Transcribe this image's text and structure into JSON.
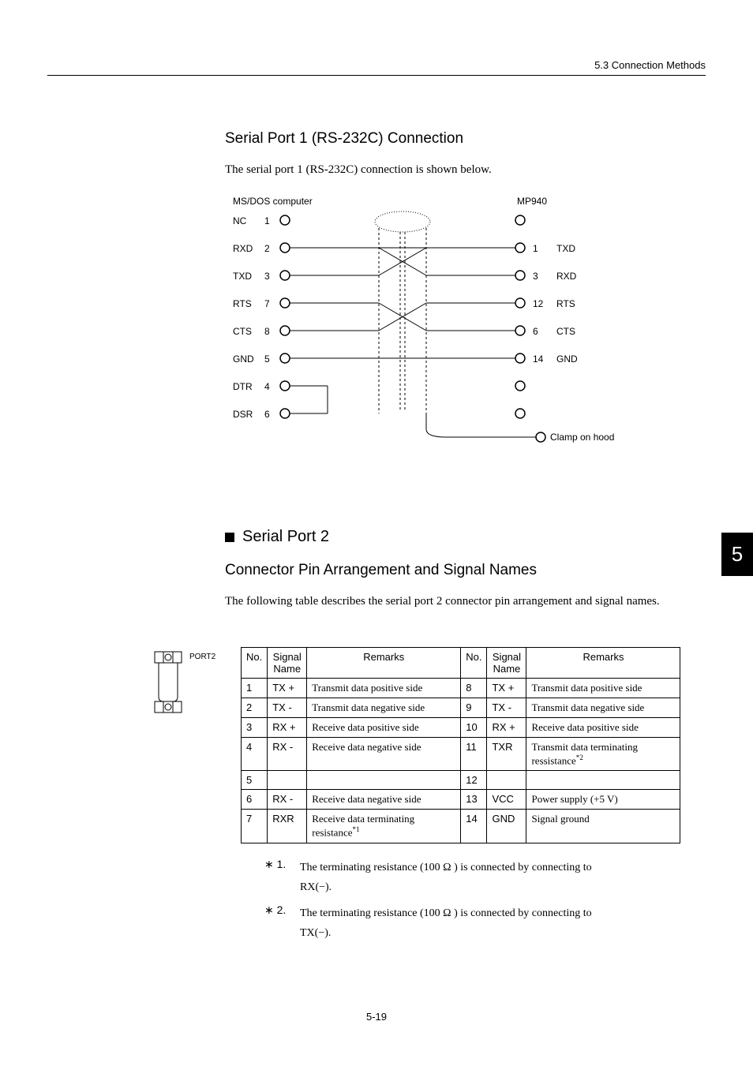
{
  "header": {
    "section": "5.3  Connection Methods"
  },
  "sec1": {
    "title": "Serial Port 1 (RS-232C) Connection",
    "intro": "The serial port 1 (RS-232C) connection is shown below."
  },
  "diagram": {
    "left_title": "MS/DOS computer",
    "right_title": "MP940",
    "left_pins": [
      {
        "label": "NC",
        "pin": "1"
      },
      {
        "label": "RXD",
        "pin": "2"
      },
      {
        "label": "TXD",
        "pin": "3"
      },
      {
        "label": "RTS",
        "pin": "7"
      },
      {
        "label": "CTS",
        "pin": "8"
      },
      {
        "label": "GND",
        "pin": "5"
      },
      {
        "label": "DTR",
        "pin": "4"
      },
      {
        "label": "DSR",
        "pin": "6"
      }
    ],
    "right_pins": [
      {
        "pin": "1",
        "label": "TXD"
      },
      {
        "pin": "3",
        "label": "RXD"
      },
      {
        "pin": "12",
        "label": "RTS"
      },
      {
        "pin": "6",
        "label": "CTS"
      },
      {
        "pin": "14",
        "label": "GND"
      }
    ],
    "clamp_label": "Clamp on hood"
  },
  "sec2": {
    "title": "Serial Port 2",
    "subtitle": "Connector Pin Arrangement and Signal Names",
    "intro": "The following table describes the serial port 2 connector pin arrangement and signal names."
  },
  "port_label": "PORT2",
  "table": {
    "headers": {
      "no": "No.",
      "signal": "Signal Name",
      "remarks": "Remarks"
    },
    "rows": [
      {
        "l_no": "1",
        "l_sig": "TX +",
        "l_rem": "Transmit data positive side",
        "r_no": "8",
        "r_sig": "TX +",
        "r_rem": "Transmit data positive side"
      },
      {
        "l_no": "2",
        "l_sig": "TX -",
        "l_rem": "Transmit data negative side",
        "r_no": "9",
        "r_sig": "TX -",
        "r_rem": "Transmit data negative side"
      },
      {
        "l_no": "3",
        "l_sig": "RX +",
        "l_rem": "Receive data positive side",
        "r_no": "10",
        "r_sig": "RX +",
        "r_rem": "Receive data positive side"
      },
      {
        "l_no": "4",
        "l_sig": "RX -",
        "l_rem": "Receive data negative side",
        "r_no": "11",
        "r_sig": "TXR",
        "r_rem": "Transmit data terminating ressistance",
        "r_sup": "*2"
      },
      {
        "l_no": "5",
        "l_sig": "",
        "l_rem": "",
        "r_no": "12",
        "r_sig": "",
        "r_rem": ""
      },
      {
        "l_no": "6",
        "l_sig": "RX -",
        "l_rem": "Receive data negative side",
        "r_no": "13",
        "r_sig": "VCC",
        "r_rem": "Power supply (+5 V)"
      },
      {
        "l_no": "7",
        "l_sig": "RXR",
        "l_rem": "Receive data terminating resistance",
        "l_sup": "*1",
        "r_no": "14",
        "r_sig": "GND",
        "r_rem": "Signal ground"
      }
    ]
  },
  "footnotes": [
    {
      "marker": "∗ 1.",
      "text1": "The terminating resistance (100 Ω ) is connected by connecting to",
      "text2": "RX(−)."
    },
    {
      "marker": "∗ 2.",
      "text1": "The terminating resistance  (100 Ω ) is connected by connecting to",
      "text2": "TX(−)."
    }
  ],
  "page_tab": "5",
  "page_footer": "5-19"
}
